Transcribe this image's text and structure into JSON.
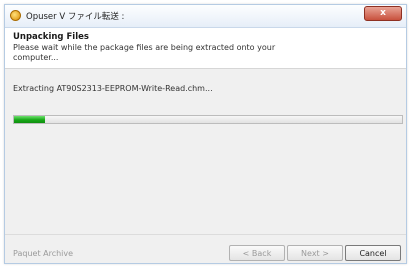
{
  "window": {
    "title": "Opuser V ファイル転送 :",
    "close_label": "x"
  },
  "header": {
    "title": "Unpacking Files",
    "description": "Please wait while the package files are being extracted onto your computer..."
  },
  "status": {
    "text": "Extracting AT90S2313-EEPROM-Write-Read.chm..."
  },
  "progress": {
    "fraction": 0.08,
    "color": "#18a818"
  },
  "footer": {
    "label": "Paquet Archive"
  },
  "buttons": {
    "back": "< Back",
    "next": "Next >",
    "cancel": "Cancel"
  }
}
